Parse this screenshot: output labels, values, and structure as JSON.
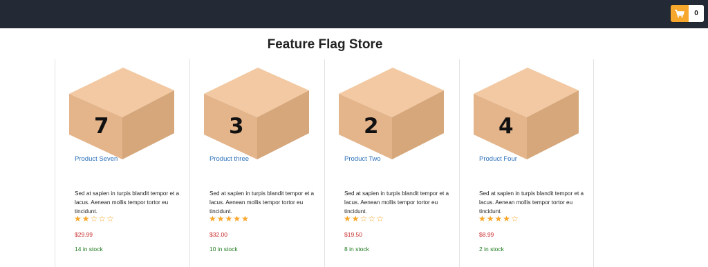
{
  "header": {
    "cart_icon": "shopping-cart-icon",
    "cart_count": "0",
    "accent_color": "#f7a72b",
    "bg_color": "#232a35"
  },
  "page": {
    "title": "Feature Flag Store"
  },
  "products": [
    {
      "name": "Product Seven",
      "box_number": "7",
      "description": "Sed at sapien in turpis blandit tempor et a lacus. Aenean mollis tempor tortor eu tincidunt.",
      "rating": 2,
      "max_rating": 5,
      "price": "$29.99",
      "stock": "14 in stock"
    },
    {
      "name": "Product three",
      "box_number": "3",
      "description": "Sed at sapien in turpis blandit tempor et a lacus. Aenean mollis tempor tortor eu tincidunt.",
      "rating": 5,
      "max_rating": 5,
      "price": "$32.00",
      "stock": "10 in stock"
    },
    {
      "name": "Product Two",
      "box_number": "2",
      "description": "Sed at sapien in turpis blandit tempor et a lacus. Aenean mollis tempor tortor eu tincidunt.",
      "rating": 2,
      "max_rating": 5,
      "price": "$19.50",
      "stock": "8 in stock"
    },
    {
      "name": "Product Four",
      "box_number": "4",
      "description": "Sed at sapien in turpis blandit tempor et a lacus. Aenean mollis tempor tortor eu tincidunt.",
      "rating": 4,
      "max_rating": 5,
      "price": "$8.99",
      "stock": "2 in stock"
    }
  ]
}
